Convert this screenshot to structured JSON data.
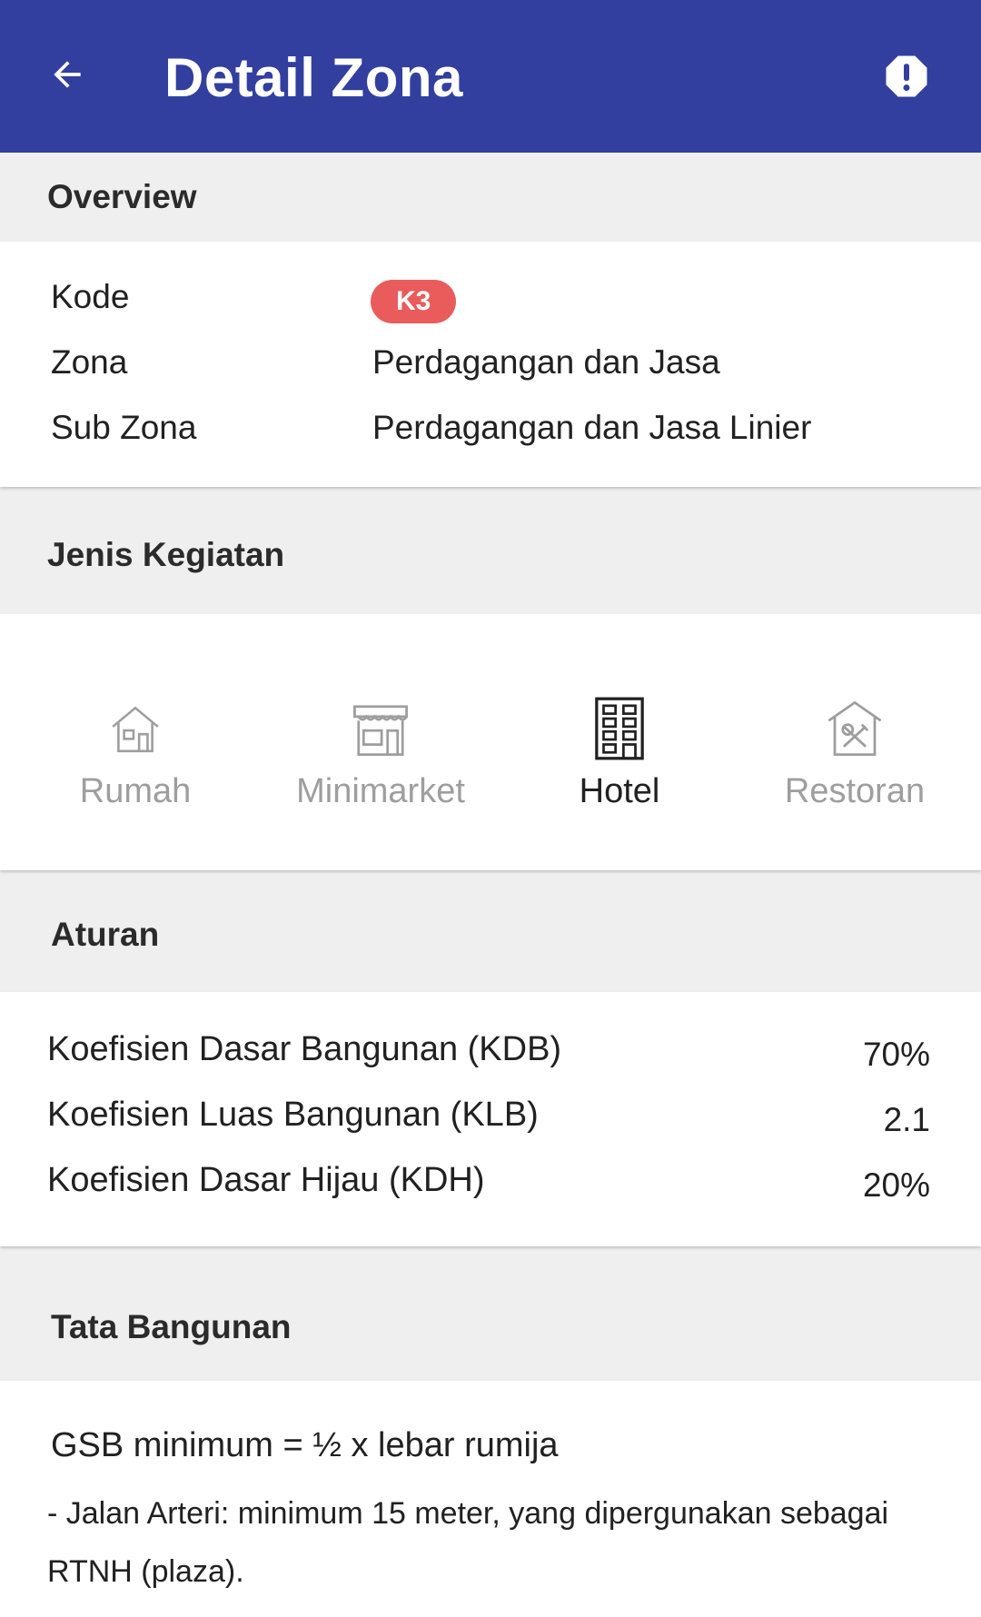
{
  "appbar": {
    "title": "Detail Zona",
    "back_icon": "arrow-left-icon",
    "info_icon": "alert-octagon-icon",
    "color": "#323f9e"
  },
  "overview": {
    "header": "Overview",
    "rows": [
      {
        "label": "Kode",
        "value": "K3"
      },
      {
        "label": "Zona",
        "value": "Perdagangan dan Jasa"
      },
      {
        "label": "Sub Zona",
        "value": "Perdagangan dan Jasa Linier"
      }
    ],
    "badge_color": "#ea5c5c"
  },
  "jenis_kegiatan": {
    "header": "Jenis Kegiatan",
    "items": [
      {
        "label": "Rumah",
        "icon": "house-icon",
        "active": false
      },
      {
        "label": "Minimarket",
        "icon": "store-icon",
        "active": false
      },
      {
        "label": "Hotel",
        "icon": "building-icon",
        "active": true
      },
      {
        "label": "Restoran",
        "icon": "restaurant-icon",
        "active": false
      }
    ]
  },
  "aturan": {
    "header": "Aturan",
    "rows": [
      {
        "label": "Koefisien Dasar Bangunan (KDB)",
        "value": "70%"
      },
      {
        "label": "Koefisien Luas Bangunan (KLB)",
        "value": "2.1"
      },
      {
        "label": "Koefisien Dasar Hijau (KDH)",
        "value": "20%"
      }
    ]
  },
  "tata_bangunan": {
    "header": "Tata Bangunan",
    "line1": "GSB minimum = ½ x lebar rumija",
    "line2": "- Jalan Arteri: minimum 15 meter, yang dipergunakan sebagai RTNH (plaza)."
  }
}
